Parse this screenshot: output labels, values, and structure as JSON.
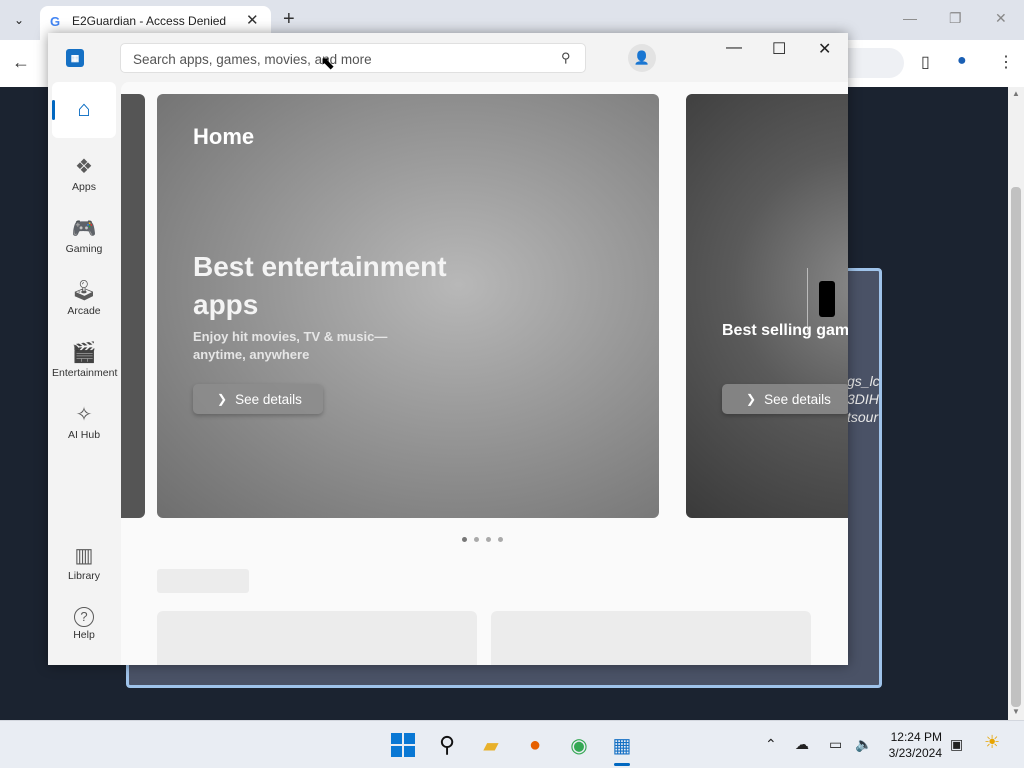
{
  "browser": {
    "tab_title": "E2Guardian - Access Denied",
    "tab_search_glyph": "⌄",
    "new_tab_glyph": "+",
    "close_glyph": "✕",
    "minimize_glyph": "—",
    "restore_glyph": "❐",
    "back_glyph": "←"
  },
  "background_page": {
    "fragments": [
      "gs_lc",
      "3DIH",
      "tsour"
    ]
  },
  "store": {
    "search": {
      "placeholder": "Search apps, games, movies, and more"
    },
    "window_controls": {
      "minimize": "—",
      "maximize": "☐",
      "close": "✕"
    },
    "nav": {
      "home": {
        "label": "Home"
      },
      "items": [
        {
          "label": "Apps",
          "icon": "apps-icon",
          "glyph": "❖"
        },
        {
          "label": "Gaming",
          "icon": "gamepad-icon",
          "glyph": "🎮"
        },
        {
          "label": "Arcade",
          "icon": "joystick-icon",
          "glyph": "🕹"
        },
        {
          "label": "Entertainment",
          "icon": "clapperboard-icon",
          "glyph": "🎬"
        },
        {
          "label": "AI Hub",
          "icon": "sparkle-icon",
          "glyph": "✧"
        }
      ],
      "bottom": [
        {
          "label": "Library",
          "icon": "library-icon",
          "glyph": "▥"
        },
        {
          "label": "Help",
          "icon": "help-icon",
          "glyph": "?"
        }
      ]
    },
    "hero": {
      "page_title": "Home",
      "title": "Best entertainment apps",
      "subtitle": "Enjoy hit movies, TV & music—anytime, anywhere",
      "cta": "See details"
    },
    "hero_next": {
      "title": "Best selling games",
      "cta": "See details"
    },
    "carousel": {
      "count": 4,
      "active_index": 0
    }
  },
  "taskbar": {
    "time": "12:24 PM",
    "date": "3/23/2024",
    "apps": [
      "start",
      "search",
      "file-explorer",
      "firefox",
      "chrome",
      "microsoft-store"
    ],
    "active_app": "microsoft-store"
  }
}
